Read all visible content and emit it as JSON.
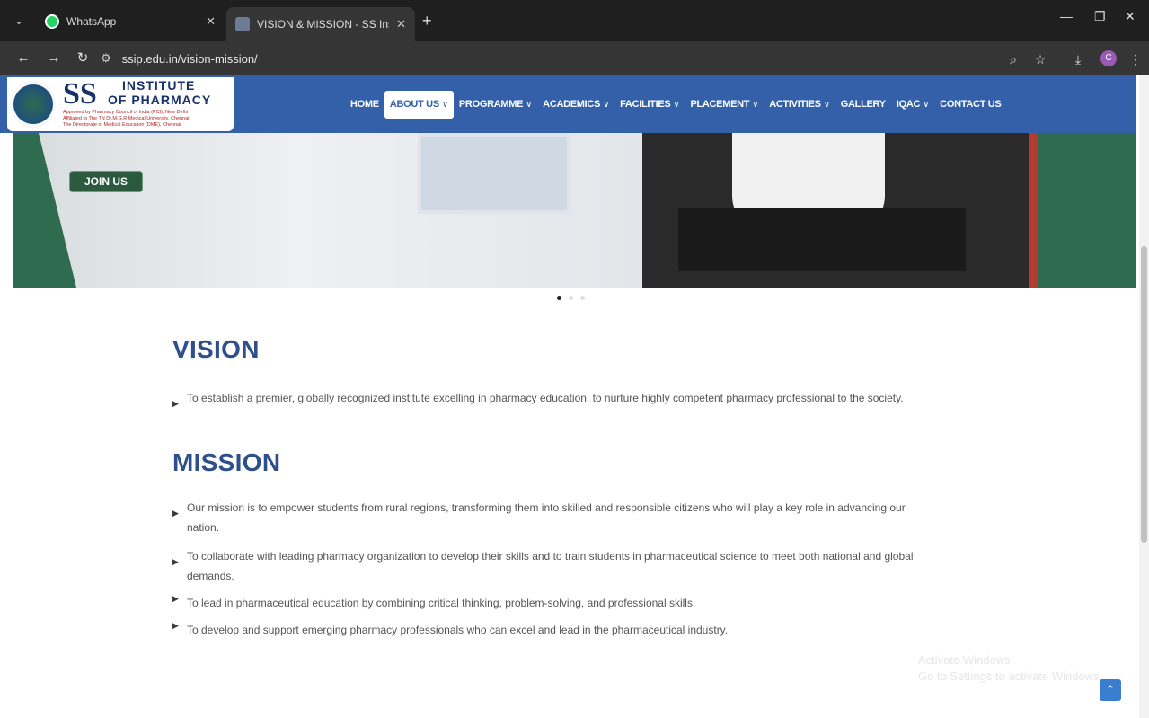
{
  "browser": {
    "tabs": [
      {
        "title": "WhatsApp",
        "icon": "whatsapp-icon"
      },
      {
        "title": "VISION & MISSION - SS Institu",
        "icon": "site-favicon"
      }
    ],
    "url": "ssip.edu.in/vision-mission/",
    "profile_initial": "C"
  },
  "site": {
    "logo": {
      "ss": "SS",
      "institute": "INSTITUTE",
      "pharmacy": "OF PHARMACY",
      "line1": "Approved by Pharmacy Council of India (PCI), New Delhi",
      "line2": "Affiliated to The TN Dr.M.G.R Medical University, Chennai",
      "line3": "The Directorate of Medical Education (DME), Chennai"
    },
    "nav": [
      {
        "label": "HOME",
        "dropdown": false,
        "active": false
      },
      {
        "label": "ABOUT US",
        "dropdown": true,
        "active": true
      },
      {
        "label": "PROGRAMME",
        "dropdown": true,
        "active": false
      },
      {
        "label": "ACADEMICS",
        "dropdown": true,
        "active": false
      },
      {
        "label": "FACILITIES",
        "dropdown": true,
        "active": false
      },
      {
        "label": "PLACEMENT",
        "dropdown": true,
        "active": false
      },
      {
        "label": "ACTIVITIES",
        "dropdown": true,
        "active": false
      },
      {
        "label": "GALLERY",
        "dropdown": false,
        "active": false
      },
      {
        "label": "IQAC",
        "dropdown": true,
        "active": false
      },
      {
        "label": "CONTACT US",
        "dropdown": false,
        "active": false
      }
    ],
    "hero": {
      "join_label": "JOIN US"
    }
  },
  "content": {
    "vision_title": "VISION",
    "vision_items": [
      "To establish a premier, globally recognized institute excelling in pharmacy education, to nurture highly competent pharmacy professional to the society."
    ],
    "mission_title": "MISSION",
    "mission_items": [
      "Our mission is to empower students from rural regions, transforming them into skilled and responsible citizens who will play a key role in advancing our nation.",
      "To collaborate with leading pharmacy organization to develop their skills and to train students in pharmaceutical science to meet both national and global demands.",
      "To lead in pharmaceutical education by combining critical thinking, problem-solving, and professional skills.",
      "To develop and support emerging pharmacy professionals who can excel and lead in the pharmaceutical industry."
    ]
  },
  "os": {
    "watermark_line1": "Activate Windows",
    "watermark_line2": "Go to Settings to activate Windows."
  },
  "colors": {
    "header_blue": "#3360a8",
    "heading_blue": "#2e4f8c",
    "join_green": "#2b5a3f"
  }
}
